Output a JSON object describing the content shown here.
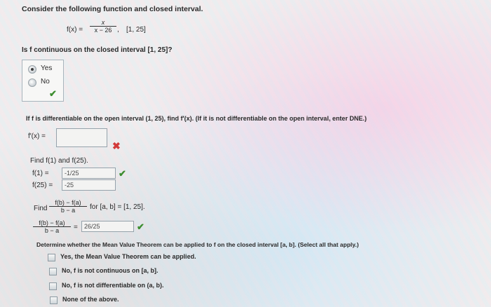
{
  "heading": "Consider the following function and closed interval.",
  "function": {
    "lhs": "f(x) =",
    "numerator": "x",
    "denominator": "x − 26",
    "sep": ",",
    "interval": "[1, 25]"
  },
  "q1": {
    "prompt": "Is f continuous on the closed interval [1, 25]?",
    "options": [
      "Yes",
      "No"
    ],
    "selected": "Yes"
  },
  "q2": {
    "prompt": "If f is differentiable on the open interval (1, 25), find f′(x). (If it is not differentiable on the open interval, enter DNE.)",
    "label": "f′(x) =",
    "value": ""
  },
  "q3": {
    "prompt": "Find f(1) and f(25).",
    "f1_label": "f(1) =",
    "f1_value": "-1/25",
    "f25_label": "f(25) =",
    "f25_value": "-25"
  },
  "q4": {
    "find_label": "Find",
    "num": "f(b) − f(a)",
    "den": "b − a",
    "suffix": "for [a, b] = [1, 25].",
    "eq": "=",
    "value": "26/25"
  },
  "q5": {
    "prompt": "Determine whether the Mean Value Theorem can be applied to f on the closed interval [a, b]. (Select all that apply.)",
    "options": [
      "Yes, the Mean Value Theorem can be applied.",
      "No, f is not continuous on [a, b].",
      "No, f is not differentiable on (a, b).",
      "None of the above."
    ]
  },
  "colors": {
    "correct": "#3c8d2f",
    "incorrect": "#d23a3a"
  },
  "icons": {
    "correct": "check-icon",
    "incorrect": "cross-icon"
  }
}
